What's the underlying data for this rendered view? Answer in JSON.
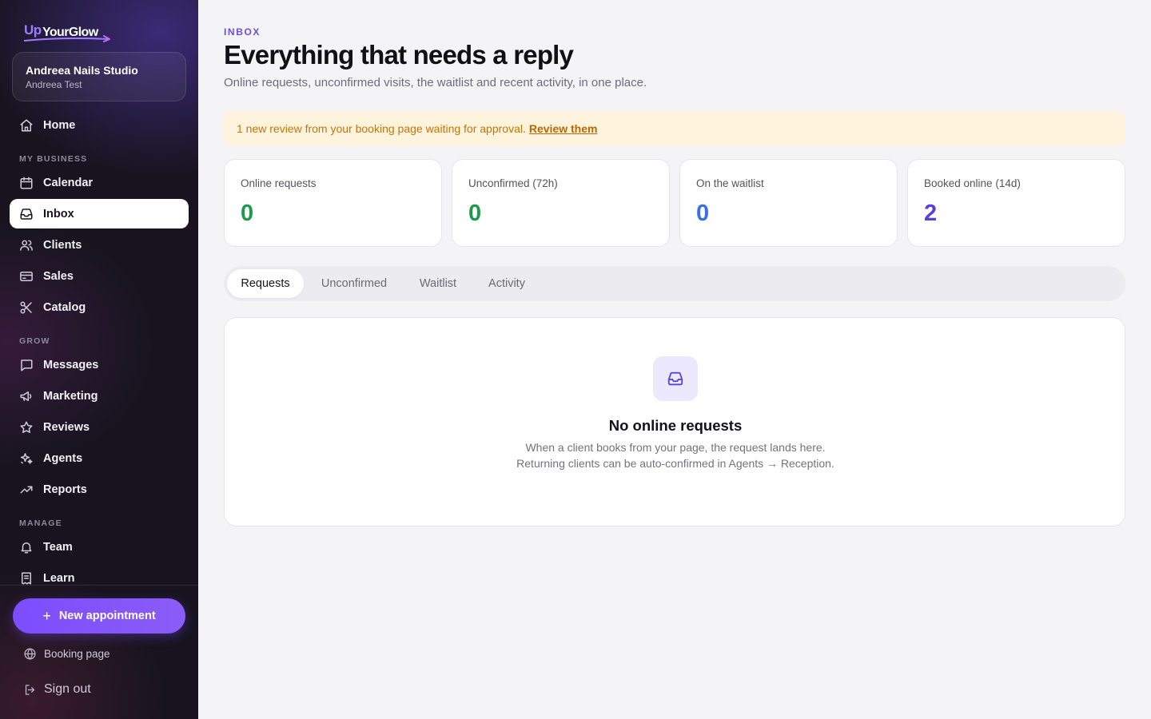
{
  "brand": {
    "logo_prefix": "Up",
    "logo_name": "YourGlow",
    "accent": "#7c4dff"
  },
  "studio": {
    "name": "Andreea Nails Studio",
    "user": "Andreea Test"
  },
  "nav": {
    "home": "Home",
    "sections": {
      "business": "MY BUSINESS",
      "grow": "GROW",
      "manage": "MANAGE"
    },
    "items": {
      "calendar": "Calendar",
      "inbox": "Inbox",
      "clients": "Clients",
      "sales": "Sales",
      "catalog": "Catalog",
      "messages": "Messages",
      "marketing": "Marketing",
      "reviews": "Reviews",
      "agents": "Agents",
      "reports": "Reports",
      "team": "Team",
      "learn": "Learn"
    },
    "active": "inbox"
  },
  "actions": {
    "new_appointment": "New appointment",
    "booking_page": "Booking page",
    "sign_out": "Sign out"
  },
  "header": {
    "eyebrow": "INBOX",
    "title": "Everything that needs a reply",
    "subtitle": "Online requests, unconfirmed visits, the waitlist and recent activity, in one place."
  },
  "banner": {
    "text": "1 new review from your booking page waiting for approval.",
    "link": "Review them",
    "color": "#c47506",
    "background": "#fef3dc"
  },
  "stats": [
    {
      "label": "Online requests",
      "value": "0",
      "color": "#1e9a4b"
    },
    {
      "label": "Unconfirmed (72h)",
      "value": "0",
      "color": "#1e9a4b"
    },
    {
      "label": "On the waitlist",
      "value": "0",
      "color": "#3a6ee8"
    },
    {
      "label": "Booked online (14d)",
      "value": "2",
      "color": "#5b3fd9"
    }
  ],
  "tabs": [
    {
      "label": "Requests",
      "active": true
    },
    {
      "label": "Unconfirmed",
      "active": false
    },
    {
      "label": "Waitlist",
      "active": false
    },
    {
      "label": "Activity",
      "active": false
    }
  ],
  "empty_state": {
    "icon": "inbox-icon",
    "title": "No online requests",
    "description": "When a client books from your page, the request lands here. Returning clients can be auto-confirmed in Agents → Reception."
  }
}
